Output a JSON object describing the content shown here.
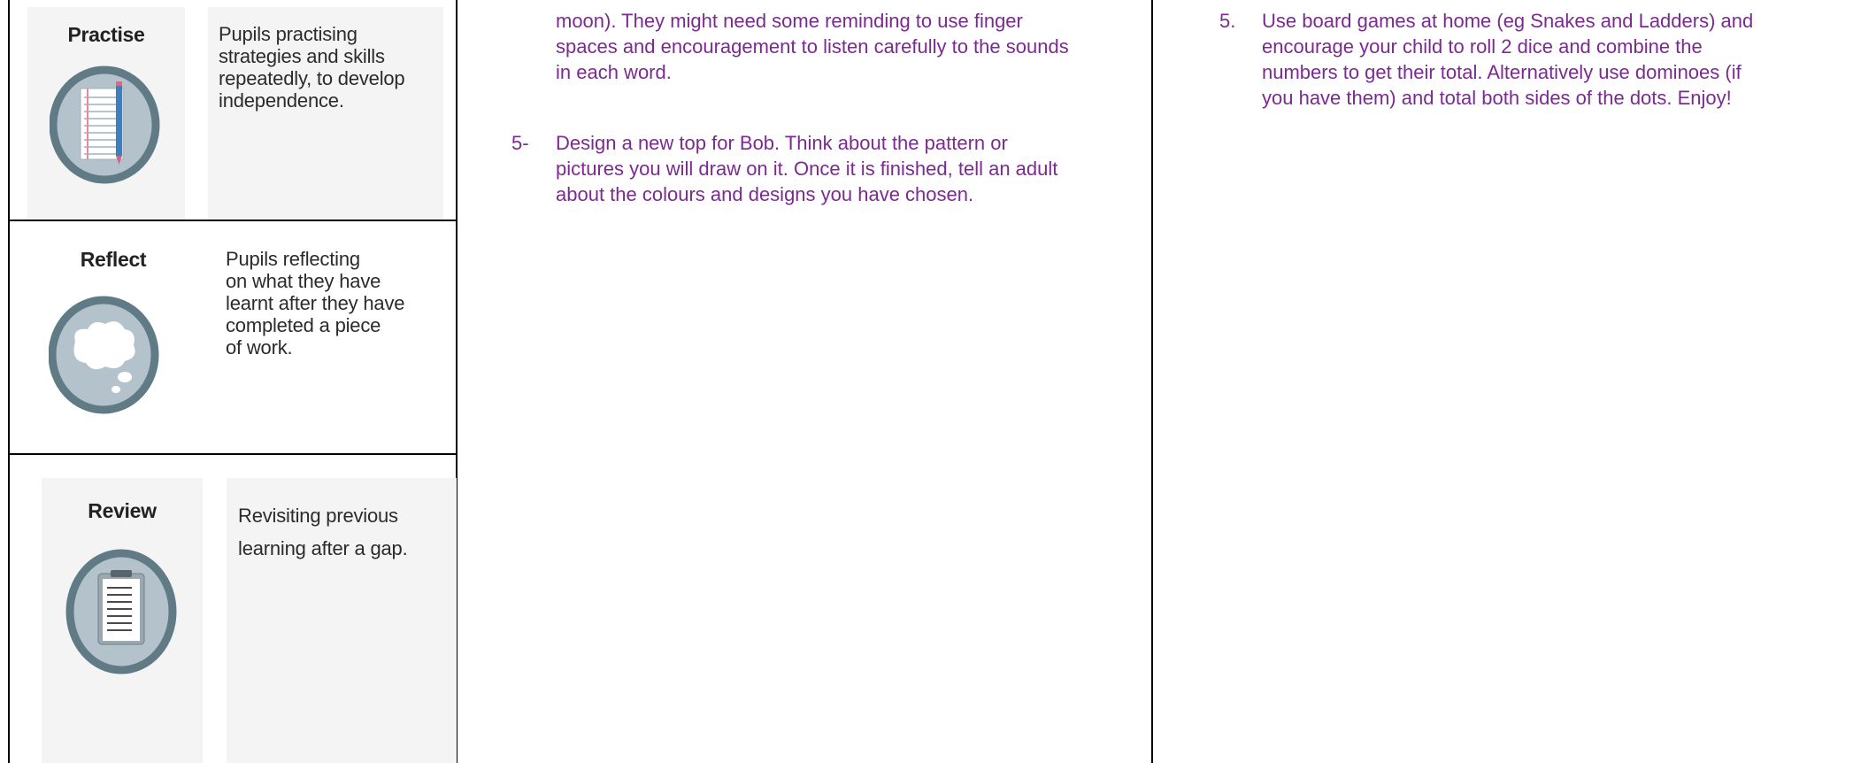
{
  "left_table": {
    "rows": [
      {
        "title": "Practise",
        "description_lines": [
          "Pupils practising",
          "strategies and skills",
          "repeatedly, to develop",
          "independence."
        ],
        "icon": "pencil-icon"
      },
      {
        "title": "Reflect",
        "description_lines": [
          "Pupils reflecting",
          "on what they have",
          "learnt after they have",
          "completed a piece",
          "of work."
        ],
        "icon": "thought-bubble-icon"
      },
      {
        "title": "Review",
        "description_lines": [
          "Revisiting previous",
          "learning after a gap."
        ],
        "icon": "clipboard-icon"
      }
    ]
  },
  "middle_column": {
    "continued_lines": [
      "moon). They might need some reminding to use finger",
      "spaces and encouragement to listen carefully to the sounds",
      "in each word."
    ],
    "item5": {
      "marker": "5-",
      "lines": [
        "Design a new top for Bob. Think about the pattern or",
        "pictures you will draw on it. Once it is finished, tell an adult",
        "about the colours and designs you have chosen."
      ]
    }
  },
  "right_column": {
    "item5": {
      "marker": "5.",
      "lines": [
        "Use board games at home (eg Snakes and Ladders) and",
        "encourage your child to roll 2 dice and combine the",
        "numbers to get their total. Alternatively use dominoes (if",
        "you have them) and total both sides of the dots. Enjoy!"
      ]
    }
  },
  "colors": {
    "purple_text": "#7b2a8f",
    "panel_bg": "#f4f4f4",
    "badge_ring": "#607a86",
    "badge_fill": "#b4c3cb"
  }
}
